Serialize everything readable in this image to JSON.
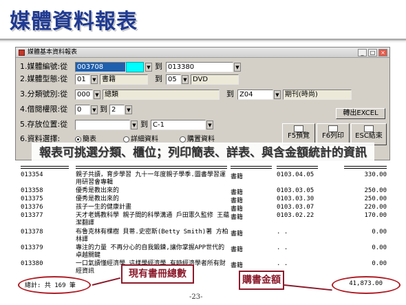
{
  "slide": {
    "title": "媒體資料報表",
    "caption": "報表可挑選分類、櫃位；列印簡表、詳表、與含金額統計的資訊",
    "page_number": "-23-"
  },
  "window": {
    "title": "媒體基本資料報表"
  },
  "form": {
    "media_no": {
      "label": "1.媒體編號:從",
      "from": "003708",
      "to_label": "到",
      "to": "013380"
    },
    "media_type": {
      "label": "2.媒體型態:從",
      "from_code": "01",
      "from_name": "書籍",
      "to_label": "到",
      "to_code": "05",
      "to_name": "DVD"
    },
    "category": {
      "label": "3.分類號別:從",
      "from_code": "000",
      "from_name": "總類",
      "to_label": "到",
      "to_code": "Z04",
      "to_name": "期刊(時尚)"
    },
    "loan_level": {
      "label": "4.借閱權限:從",
      "from": "0",
      "to_label": "到",
      "to": "2"
    },
    "shelf": {
      "label": "5.存放位置:從",
      "from": "",
      "to_label": "到",
      "to": "C-1"
    },
    "output_label": "6.資料選擇:",
    "radio_options": [
      "簡表",
      "詳細資料",
      "購置資料"
    ],
    "selected_radio": "簡表"
  },
  "buttons": {
    "excel": "轉出EXCEL",
    "preview": "F5預覽",
    "print": "F6列印",
    "esc": "ESC結束"
  },
  "report": {
    "records": [
      {
        "id": "013354",
        "title": "親子共讀，育步學習 九十一年度親子學季.圖書學習運用研習會專輯",
        "type": "書籍",
        "date": "0103.04.05",
        "amount": "330.00"
      },
      {
        "id": "013358",
        "title": "優秀是教出來的",
        "type": "書籍",
        "date": "0103.03.05",
        "amount": "250.00"
      },
      {
        "id": "013375",
        "title": "優秀是教出來的",
        "type": "書籍",
        "date": "0103.03.30",
        "amount": "250.00"
      },
      {
        "id": "013376",
        "title": "孩子一生的健康計畫",
        "type": "書籍",
        "date": "0103.03.07",
        "amount": "220.00"
      },
      {
        "id": "013377",
        "title": "天才老媽教科學 親子間的科學溝通 戶田憲久監修 王蘊潔翻譯",
        "type": "書籍",
        "date": "0103.02.22",
        "amount": "170.00"
      },
      {
        "id": "013378",
        "title": "布魯克林有棵樹 貝蒂.史密斯(Betty Smith)著 方柏林譯",
        "type": "書籍",
        "date": ". .",
        "amount": "0.00"
      },
      {
        "id": "013379",
        "title": "專注的力量 不再分心的自我鍛鍊,讓你掌握APP世代的卓越關鍵",
        "type": "書籍",
        "date": ". .",
        "amount": "0.00"
      },
      {
        "id": "013380",
        "title": "一口氣讀懂經濟學 這樣學經濟學 有時經濟學者所有財經資訊",
        "type": "書籍",
        "date": ". .",
        "amount": "0.00"
      }
    ],
    "total_label": "總計: 共 169 筆",
    "total_amount": "41,873.00"
  },
  "annotations": {
    "book_count": "現有書冊總數",
    "purchase_amount": "購書金額"
  },
  "colors": {
    "title_blue": "#1f3a93",
    "annotation_red": "#8b1a2b",
    "selection_blue": "#1e5fae",
    "field_cyan": "#00ffff"
  }
}
